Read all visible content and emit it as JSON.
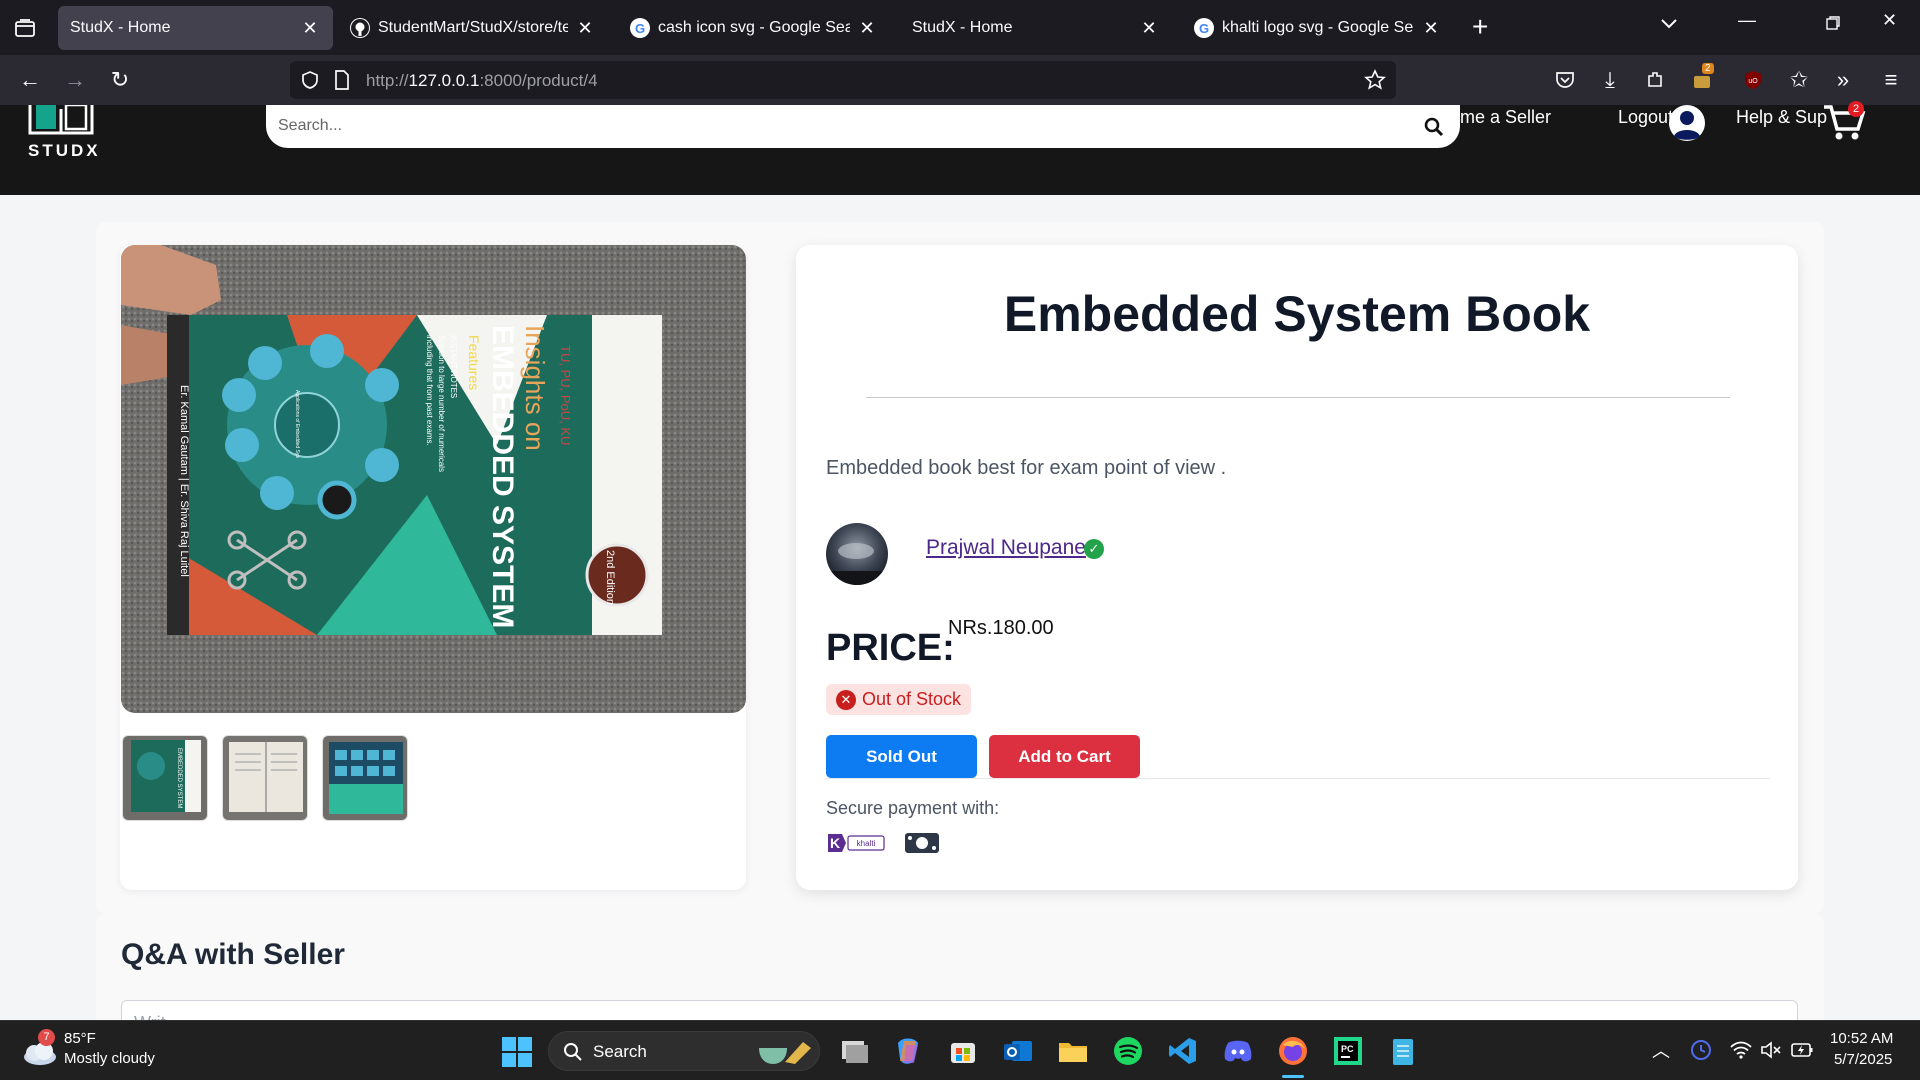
{
  "browser": {
    "tabs": [
      {
        "label": "StudX - Home",
        "active": true
      },
      {
        "label": "StudentMart/StudX/store/templ"
      },
      {
        "label": "cash icon svg - Google Search"
      },
      {
        "label": "StudX - Home"
      },
      {
        "label": "khalti logo svg - Google Search"
      }
    ],
    "url_prefix": "http://",
    "url_host": "127.0.0.1",
    "url_path": ":8000/product/4",
    "extension_badge": "2"
  },
  "site": {
    "logo_text": "STUDX",
    "search_placeholder": "Search...",
    "nav": {
      "become_seller": "ome a Seller",
      "logout": "Logout",
      "help": "Help & Sup",
      "cart_count": "2"
    }
  },
  "product": {
    "title": "Embedded System Book",
    "description": "Embedded book best for exam point of view .",
    "seller_name": "Prajwal Neupane",
    "price_label": "PRICE:",
    "price_value": "NRs.180.00",
    "stock_status": "Out of Stock",
    "sold_out_label": "Sold Out",
    "add_to_cart_label": "Add to Cart",
    "secure_payment_text": "Secure payment with:",
    "payment_methods": [
      "khalti",
      "cash"
    ],
    "book_cover": {
      "series": "TU, PU, PoU, KU",
      "title_line1": "Insights on",
      "title_line2": "EMBEDDED SYSTEM",
      "features_heading": "Features",
      "feature_1": "INSTANT NOTES",
      "feature_2": "Solution to large number of numericals",
      "feature_3": "including that from past exams.",
      "edition": "2nd Edition",
      "authors": "Er. Kamal Gautam | Er. Shiva Raj Luitel",
      "wheel_label": "Applications of Embedded Sys"
    },
    "thumb_text": "EMBEDDED SYSTEM"
  },
  "qa": {
    "title": "Q&A with Seller",
    "input_placeholder": "Writ"
  },
  "taskbar": {
    "weather_temp": "85°F",
    "weather_desc": "Mostly cloudy",
    "weather_badge": "7",
    "search_label": "Search",
    "time": "10:52 AM",
    "date": "5/7/2025"
  },
  "colors": {
    "sold_out_button": "#0d7bf2",
    "add_to_cart_button": "#dc2f3f",
    "header_bg": "#161616",
    "verified_green": "#22a34a",
    "khalti_purple": "#5c2d91"
  }
}
